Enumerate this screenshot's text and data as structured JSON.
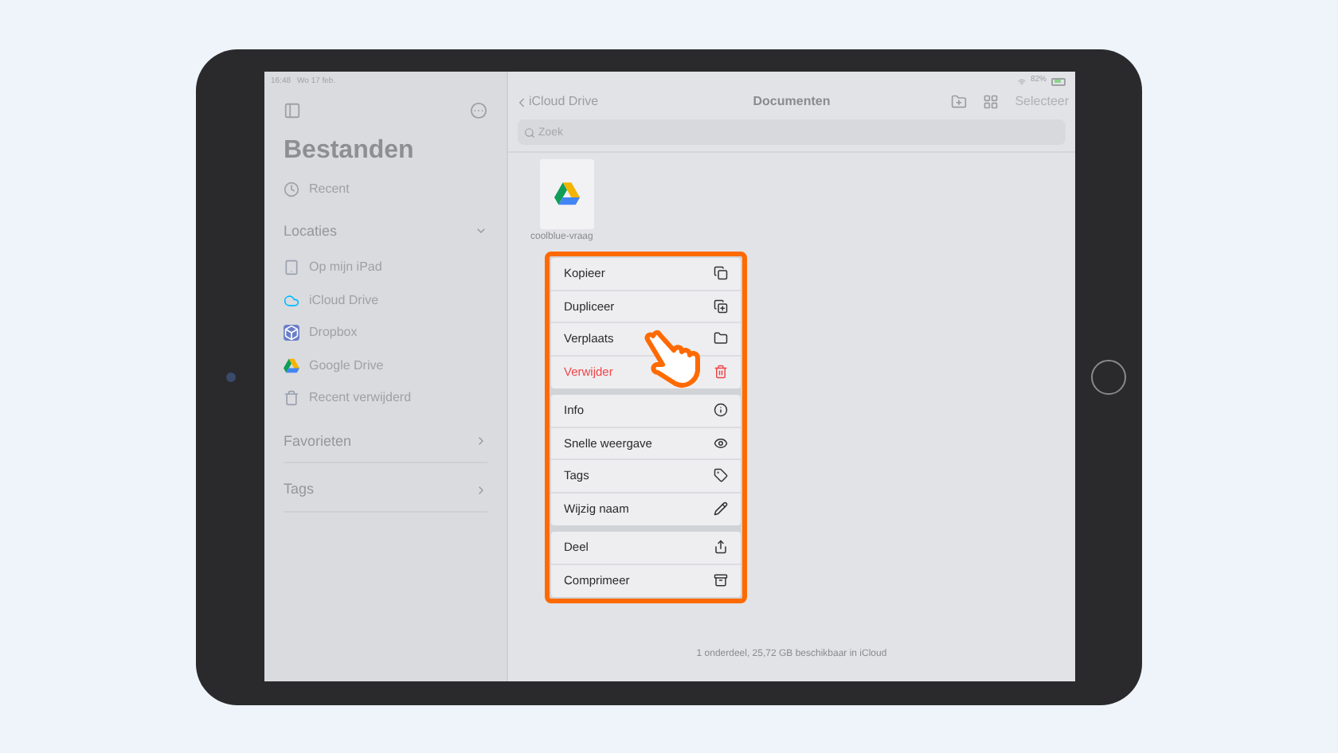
{
  "status_bar": {
    "time": "16:48",
    "date": "Wo 17 feb.",
    "battery": "82%"
  },
  "sidebar": {
    "title": "Bestanden",
    "recent": "Recent",
    "sections": [
      {
        "title": "Locaties",
        "expanded": true,
        "items": [
          "Op mijn iPad",
          "iCloud Drive",
          "Dropbox",
          "Google Drive",
          "Recent verwijderd"
        ]
      },
      {
        "title": "Favorieten",
        "expanded": false
      },
      {
        "title": "Tags",
        "expanded": false
      }
    ]
  },
  "navbar": {
    "back": "iCloud Drive",
    "title": "Documenten",
    "select": "Selecteer"
  },
  "search": {
    "placeholder": "Zoek"
  },
  "file": {
    "name": "coolblue-vraag"
  },
  "menu": [
    [
      {
        "label": "Kopieer",
        "destructive": false
      },
      {
        "label": "Dupliceer",
        "destructive": false
      },
      {
        "label": "Verplaats",
        "destructive": false
      },
      {
        "label": "Verwijder",
        "destructive": true
      }
    ],
    [
      {
        "label": "Info",
        "destructive": false
      },
      {
        "label": "Snelle weergave",
        "destructive": false
      },
      {
        "label": "Tags",
        "destructive": false
      },
      {
        "label": "Wijzig naam",
        "destructive": false
      }
    ],
    [
      {
        "label": "Deel",
        "destructive": false
      },
      {
        "label": "Comprimeer",
        "destructive": false
      }
    ]
  ],
  "footer": "1 onderdeel, 25,72 GB beschikbaar in iCloud"
}
